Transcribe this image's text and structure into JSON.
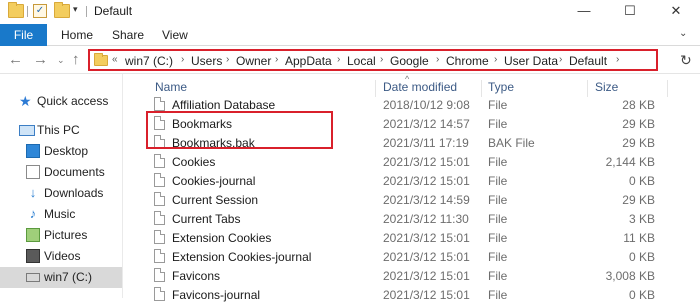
{
  "window": {
    "title": "Default",
    "controls": {
      "minimize": "—",
      "maximize": "☐",
      "close": "✕"
    }
  },
  "ribbon": {
    "tabs": [
      "File",
      "Home",
      "Share",
      "View"
    ],
    "expand_icon": "chevron-down-icon"
  },
  "address": {
    "overflow": "«",
    "crumbs": [
      "win7 (C:)",
      "Users",
      "Owner",
      "AppData",
      "Local",
      "Google",
      "Chrome",
      "User Data",
      "Default"
    ],
    "separator": "›"
  },
  "nav_pane": {
    "items": [
      {
        "label": "Quick access",
        "icon": "star-icon"
      },
      {
        "label": "This PC",
        "icon": "computer-icon"
      },
      {
        "label": "Desktop",
        "icon": "desktop-icon"
      },
      {
        "label": "Documents",
        "icon": "documents-icon"
      },
      {
        "label": "Downloads",
        "icon": "downloads-icon"
      },
      {
        "label": "Music",
        "icon": "music-icon"
      },
      {
        "label": "Pictures",
        "icon": "pictures-icon"
      },
      {
        "label": "Videos",
        "icon": "videos-icon"
      },
      {
        "label": "win7 (C:)",
        "icon": "drive-icon"
      }
    ]
  },
  "file_list": {
    "columns": {
      "name": "Name",
      "date": "Date modified",
      "type": "Type",
      "size": "Size"
    },
    "rows": [
      {
        "name": "Affiliation Database",
        "date": "2018/10/12 9:08",
        "type": "File",
        "size": "28 KB"
      },
      {
        "name": "Bookmarks",
        "date": "2021/3/12 14:57",
        "type": "File",
        "size": "29 KB"
      },
      {
        "name": "Bookmarks.bak",
        "date": "2021/3/11 17:19",
        "type": "BAK File",
        "size": "29 KB"
      },
      {
        "name": "Cookies",
        "date": "2021/3/12 15:01",
        "type": "File",
        "size": "2,144 KB"
      },
      {
        "name": "Cookies-journal",
        "date": "2021/3/12 15:01",
        "type": "File",
        "size": "0 KB"
      },
      {
        "name": "Current Session",
        "date": "2021/3/12 14:59",
        "type": "File",
        "size": "29 KB"
      },
      {
        "name": "Current Tabs",
        "date": "2021/3/12 11:30",
        "type": "File",
        "size": "3 KB"
      },
      {
        "name": "Extension Cookies",
        "date": "2021/3/12 15:01",
        "type": "File",
        "size": "11 KB"
      },
      {
        "name": "Extension Cookies-journal",
        "date": "2021/3/12 15:01",
        "type": "File",
        "size": "0 KB"
      },
      {
        "name": "Favicons",
        "date": "2021/3/12 15:01",
        "type": "File",
        "size": "3,008 KB"
      },
      {
        "name": "Favicons-journal",
        "date": "2021/3/12 15:01",
        "type": "File",
        "size": "0 KB"
      }
    ]
  },
  "colors": {
    "file_tab": "#1979ca",
    "highlight": "#d9202b"
  }
}
